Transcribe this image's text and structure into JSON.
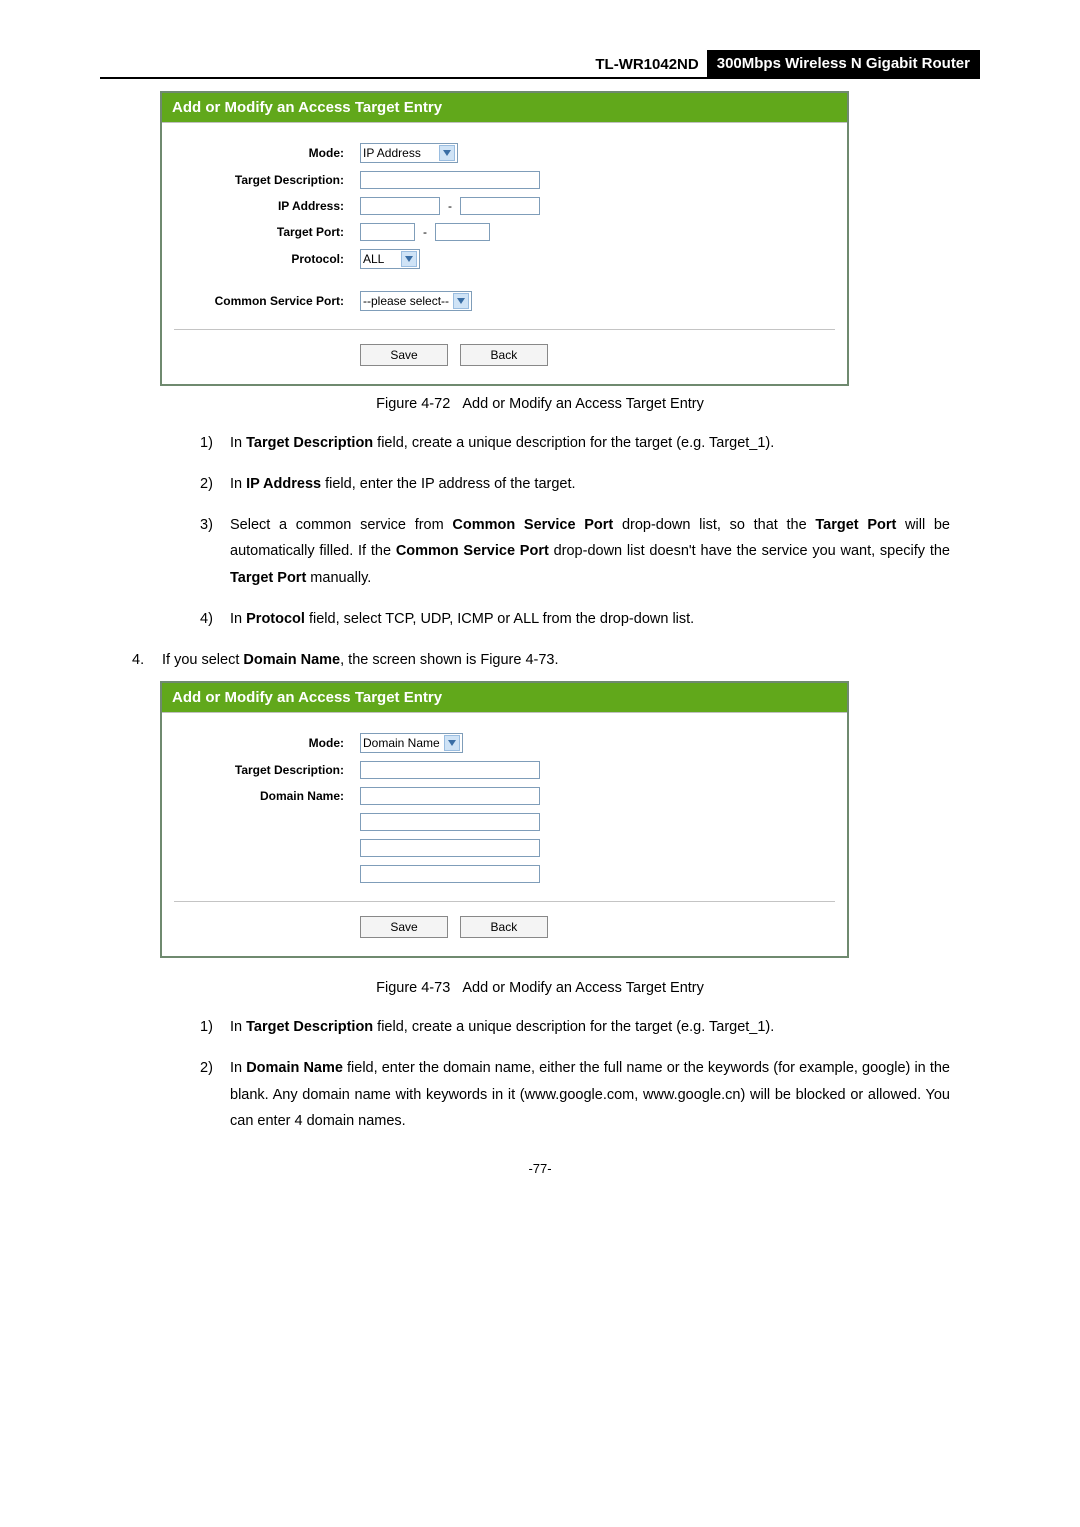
{
  "header": {
    "model": "TL-WR1042ND",
    "desc": "300Mbps Wireless N Gigabit Router"
  },
  "screenshot1": {
    "title": "Add or Modify an Access Target Entry",
    "labels": {
      "mode": "Mode:",
      "target_desc": "Target Description:",
      "ip": "IP Address:",
      "port": "Target Port:",
      "protocol": "Protocol:",
      "common": "Common Service Port:"
    },
    "mode_value": "IP Address",
    "protocol_value": "ALL",
    "common_value": "--please select--",
    "save": "Save",
    "back": "Back"
  },
  "caption1_a": "Figure 4-72",
  "caption1_b": "Add or Modify an Access Target Entry",
  "steps1": {
    "n1": "1)",
    "t1a": "In ",
    "t1b": "Target Description",
    "t1c": " field, create a unique description for the target (e.g. Target_1).",
    "n2": "2)",
    "t2a": "In ",
    "t2b": "IP Address",
    "t2c": " field, enter the IP address of the target.",
    "n3": "3)",
    "t3a": "Select a common service from ",
    "t3b": "Common Service Port",
    "t3c": " drop-down list, so that the ",
    "t3d": "Target Port",
    "t3e": " will be automatically filled. If the ",
    "t3f": "Common Service Port",
    "t3g": " drop-down list doesn't have the service you want, specify the ",
    "t3h": "Target Port",
    "t3i": " manually.",
    "n4": "4)",
    "t4a": "In ",
    "t4b": "Protocol",
    "t4c": " field, select TCP, UDP, ICMP or ALL from the drop-down list."
  },
  "outer": {
    "num": "4.",
    "a": "If you select ",
    "b": "Domain Name",
    "c": ", the screen shown is Figure 4-73."
  },
  "screenshot2": {
    "title": "Add or Modify an Access Target Entry",
    "labels": {
      "mode": "Mode:",
      "target_desc": "Target Description:",
      "domain": "Domain Name:"
    },
    "mode_value": "Domain Name",
    "save": "Save",
    "back": "Back"
  },
  "caption2_a": "Figure 4-73",
  "caption2_b": "Add or Modify an Access Target Entry",
  "steps2": {
    "n1": "1)",
    "t1a": "In ",
    "t1b": "Target Description",
    "t1c": " field, create a unique description for the target (e.g. Target_1).",
    "n2": "2)",
    "t2a": "In ",
    "t2b": "Domain Name",
    "t2c": " field, enter the domain name, either the full name or the keywords (for example, google) in the blank. Any domain name with keywords in it (www.google.com, www.google.cn) will be blocked or allowed. You can enter 4 domain names."
  },
  "pagenum": "-77-"
}
